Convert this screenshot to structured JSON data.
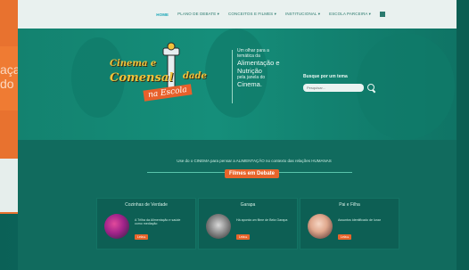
{
  "background": {
    "left_card_text_line1": "aça",
    "left_card_text_line2": "do d"
  },
  "nav": {
    "items": [
      {
        "label": "HOME",
        "active": true
      },
      {
        "label": "PLANO DE DEBATE ▾",
        "active": false
      },
      {
        "label": "CONCEITOS E FILMES ▾",
        "active": false
      },
      {
        "label": "INSTITUCIONAL ▾",
        "active": false
      },
      {
        "label": "ESCOLA PARCEIRA ▾",
        "active": false
      }
    ]
  },
  "hero": {
    "logo_line1": "Cinema e",
    "logo_line2": "Comensal",
    "logo_line3": "dade",
    "logo_stamp": "na Escola",
    "tagline_small1": "Um olhar para a",
    "tagline_small2": "temática da",
    "tagline_big1": "Alimentação e",
    "tagline_big2": "Nutrição",
    "tagline_small3": "pela janela do",
    "tagline_big3": "Cinema.",
    "search_label": "Busque por um tema",
    "search_placeholder": "Pesquisar..."
  },
  "section": {
    "intro": "Use do o CINEMA para pensar a ALIMENTAÇÃO no contexto das relações HUMANAS",
    "badge": "Filmes em Debate"
  },
  "cards": [
    {
      "title": "Cozinhas de Verdade",
      "desc": "A Trilha da Alimentação e saúde como mediação",
      "button": "Leia ▸"
    },
    {
      "title": "Garapa",
      "desc": "Há aponta um filme de Bela Garapa",
      "button": "Leia ▸"
    },
    {
      "title": "Pai e Filha",
      "desc": "Assuntos identificado de lunar",
      "button": "Leia ▸"
    }
  ],
  "colors": {
    "accent_orange": "#e8652b",
    "primary_green": "#0f6b60",
    "nav_active": "#19a6b6"
  }
}
